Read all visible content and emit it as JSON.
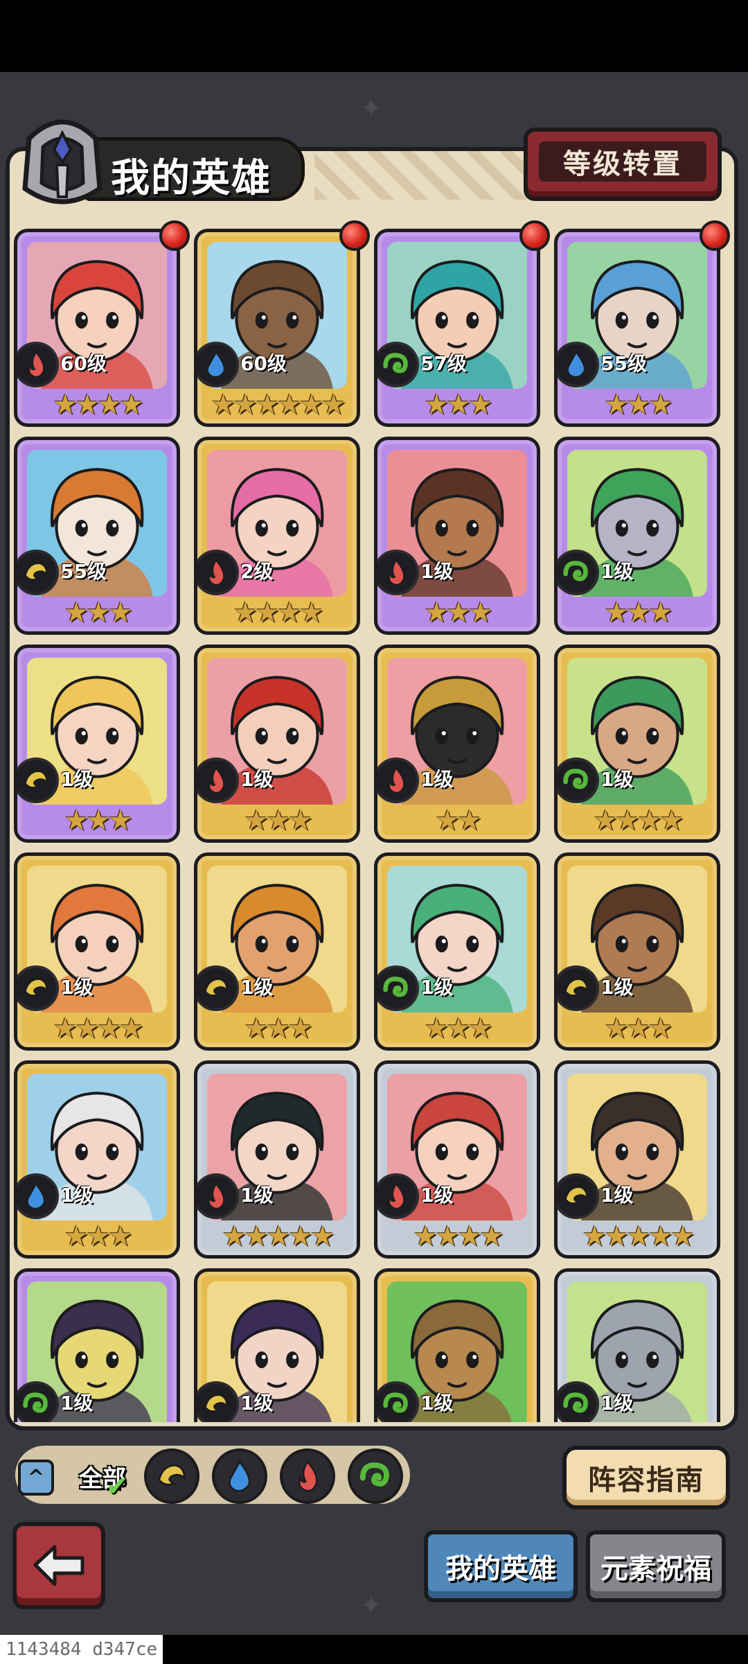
{
  "header": {
    "title": "我的英雄",
    "transfer_button": "等级转置"
  },
  "colors": {
    "fire": "#e0534f",
    "water": "#3f8fe0",
    "wind": "#58b83c",
    "earth": "#e3c34a",
    "panel": "#e8dcc1",
    "gold_frame": "#e7bd52",
    "purple_frame": "#b78be8",
    "silver_frame": "#c3cbd6"
  },
  "heroes": [
    {
      "level": "60级",
      "stars": "★★★★",
      "element": "fire",
      "rarity": "purple",
      "badge": true,
      "hair": "#d9453c",
      "skin": "#f6d1bd",
      "bg": "#e6a7b5"
    },
    {
      "level": "60级",
      "stars": "★★★★★★",
      "element": "water",
      "rarity": "gold",
      "badge": true,
      "hair": "#6b4a2f",
      "skin": "#8a6244",
      "bg": "#a9d7ec"
    },
    {
      "level": "57级",
      "stars": "★★★",
      "element": "wind",
      "rarity": "purple",
      "badge": true,
      "hair": "#2fa4a5",
      "skin": "#f4cdb6",
      "bg": "#9ad3c4"
    },
    {
      "level": "55级",
      "stars": "★★★",
      "element": "water",
      "rarity": "purple",
      "badge": true,
      "hair": "#5aa0d8",
      "skin": "#e7d4c6",
      "bg": "#98d3a4"
    },
    {
      "level": "55级",
      "stars": "★★★",
      "element": "earth",
      "rarity": "purple",
      "badge": false,
      "hair": "#d97a33",
      "skin": "#f2e6d8",
      "bg": "#7ec6e6"
    },
    {
      "level": "2级",
      "stars": "★★★★",
      "element": "fire",
      "rarity": "gold",
      "badge": false,
      "hair": "#e66ca6",
      "skin": "#f6d2c2",
      "bg": "#ed9ba3"
    },
    {
      "level": "1级",
      "stars": "★★★",
      "element": "fire",
      "rarity": "purple",
      "badge": false,
      "hair": "#5b3324",
      "skin": "#b4794f",
      "bg": "#eb8f96"
    },
    {
      "level": "1级",
      "stars": "★★★",
      "element": "wind",
      "rarity": "purple",
      "badge": false,
      "hair": "#3fa35a",
      "skin": "#b5b3c6",
      "bg": "#c3e08a"
    },
    {
      "level": "1级",
      "stars": "★★★",
      "element": "earth",
      "rarity": "purple",
      "badge": false,
      "hair": "#f0c55a",
      "skin": "#f6d4c2",
      "bg": "#eddf86"
    },
    {
      "level": "1级",
      "stars": "★★★",
      "element": "fire",
      "rarity": "gold",
      "badge": false,
      "hair": "#c73328",
      "skin": "#f3cfbb",
      "bg": "#eba0a6"
    },
    {
      "level": "1级",
      "stars": "★★",
      "element": "fire",
      "rarity": "gold",
      "badge": false,
      "hair": "#c79a3a",
      "skin": "#2d2b2a",
      "bg": "#ef9ea4"
    },
    {
      "level": "1级",
      "stars": "★★★★",
      "element": "wind",
      "rarity": "gold",
      "badge": false,
      "hair": "#3c9a5c",
      "skin": "#d8a784",
      "bg": "#c8e28c"
    },
    {
      "level": "1级",
      "stars": "★★★★",
      "element": "earth",
      "rarity": "gold",
      "badge": false,
      "hair": "#e2783c",
      "skin": "#f5d1bb",
      "bg": "#f0d98a"
    },
    {
      "level": "1级",
      "stars": "★★★",
      "element": "earth",
      "rarity": "gold",
      "badge": false,
      "hair": "#d98a2c",
      "skin": "#e3a16f",
      "bg": "#f0d98a"
    },
    {
      "level": "1级",
      "stars": "★★★",
      "element": "wind",
      "rarity": "gold",
      "badge": false,
      "hair": "#4ab07a",
      "skin": "#f4d6c8",
      "bg": "#a9dad5"
    },
    {
      "level": "1级",
      "stars": "★★★",
      "element": "earth",
      "rarity": "gold",
      "badge": false,
      "hair": "#5a3a26",
      "skin": "#b07a52",
      "bg": "#f0d98a"
    },
    {
      "level": "1级",
      "stars": "★★★",
      "element": "water",
      "rarity": "gold",
      "badge": false,
      "hair": "#e6e6e6",
      "skin": "#f4d6c8",
      "bg": "#9fd0ea"
    },
    {
      "level": "1级",
      "stars": "★★★★★",
      "element": "fire",
      "rarity": "silver",
      "badge": false,
      "hair": "#1f2b2a",
      "skin": "#f3d6c6",
      "bg": "#eca3a8"
    },
    {
      "level": "1级",
      "stars": "★★★★",
      "element": "fire",
      "rarity": "silver",
      "badge": false,
      "hair": "#c9453e",
      "skin": "#f5d1be",
      "bg": "#ec9fa5"
    },
    {
      "level": "1级",
      "stars": "★★★★★",
      "element": "earth",
      "rarity": "silver",
      "badge": false,
      "hair": "#3b2f2a",
      "skin": "#e2b08b",
      "bg": "#f0d98a"
    },
    {
      "level": "1级",
      "stars": "★★★",
      "element": "wind",
      "rarity": "purple",
      "badge": false,
      "hair": "#3a2f4d",
      "skin": "#e6d874",
      "bg": "#b5d98a"
    },
    {
      "level": "1级",
      "stars": "★★★",
      "element": "earth",
      "rarity": "gold",
      "badge": false,
      "hair": "#3a2b57",
      "skin": "#f2d4c6",
      "bg": "#f0d98a"
    },
    {
      "level": "1级",
      "stars": "★★★",
      "element": "wind",
      "rarity": "gold",
      "badge": false,
      "hair": "#8a6a3a",
      "skin": "#b7894e",
      "bg": "#6fbf5a"
    },
    {
      "level": "1级",
      "stars": "★★★",
      "element": "wind",
      "rarity": "silver",
      "badge": false,
      "hair": "#9ea4ad",
      "skin": "#9ea4ad",
      "bg": "#c4e28e"
    }
  ],
  "filter": {
    "all_label": "全部",
    "elements": [
      "earth",
      "water",
      "fire",
      "wind"
    ]
  },
  "guide_button": "阵容指南",
  "tabs": {
    "mine": "我的英雄",
    "blessing": "元素祝福"
  },
  "debug_text": "1143484 d347ce"
}
